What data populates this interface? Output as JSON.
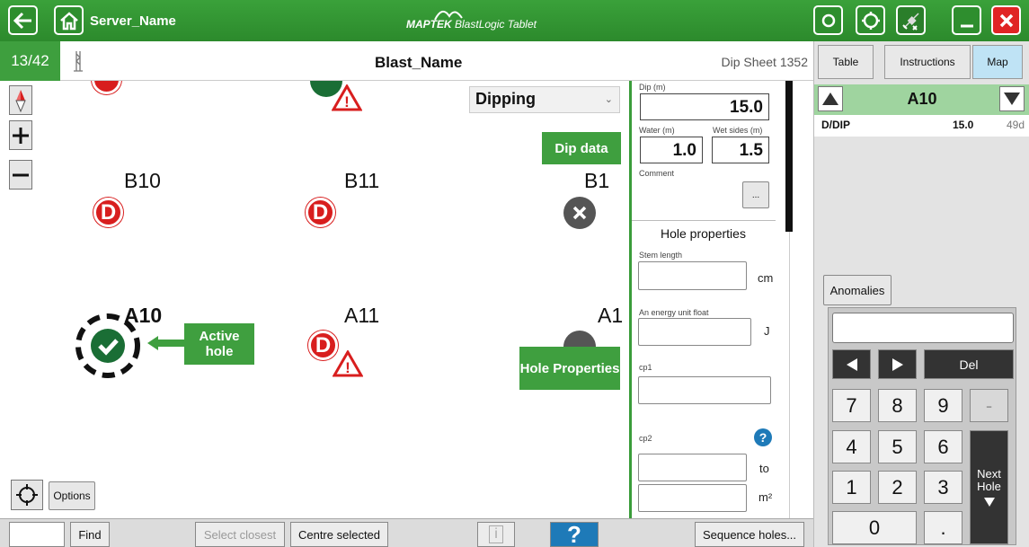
{
  "topbar": {
    "server_name": "Server_Name",
    "brand_logo": "MAPTEK",
    "brand_app": "BlastLogic Tablet",
    "icons": [
      "back-arrow-icon",
      "home-icon",
      "sync-icon",
      "gps-target-icon",
      "satellite-off-icon",
      "minimize-icon",
      "close-icon"
    ],
    "close_color": "#e02424"
  },
  "subheader": {
    "counter": "13/42",
    "blast_name": "Blast_Name",
    "dip_sheet": "Dip Sheet 1352"
  },
  "map": {
    "holes": [
      {
        "label": "B10",
        "status": "D"
      },
      {
        "label": "B11",
        "status": "D"
      },
      {
        "label": "B1",
        "status": "x"
      },
      {
        "label": "A10",
        "status": "active"
      },
      {
        "label": "A11",
        "status": "D-warning"
      },
      {
        "label": "A1",
        "status": "x"
      }
    ],
    "dip_data_callout": "Dip data",
    "active_hole_callout": "Active hole",
    "hole_properties_callout": "Hole Properties",
    "mode_select": "Dipping",
    "options_label": "Options"
  },
  "dip_panel": {
    "dip_label": "Dip (m)",
    "dip_value": "15.0",
    "water_label": "Water (m)",
    "water_value": "1.0",
    "wet_sides_label": "Wet sides (m)",
    "wet_sides_value": "1.5",
    "comment_label": "Comment",
    "comment_button": "...",
    "hole_properties_title": "Hole properties",
    "stem_length_label": "Stem length",
    "stem_length_unit": "cm",
    "energy_label": "An energy unit float",
    "energy_unit": "J",
    "cp1_label": "cp1",
    "cp2_label": "cp2",
    "cp2_to": "to",
    "cp2_unit": "m²",
    "help_icon": "?"
  },
  "right_panel": {
    "tabs": [
      "Table",
      "Instructions",
      "Map"
    ],
    "active_tab": "Map",
    "hole_name": "A10",
    "row": {
      "type": "D/DIP",
      "value": "15.0",
      "age": "49d"
    },
    "anomalies_label": "Anomalies",
    "keypad": {
      "del": "Del",
      "digits": [
        "7",
        "8",
        "9",
        "4",
        "5",
        "6",
        "1",
        "2",
        "3",
        "0",
        "."
      ],
      "minus": "-",
      "next_hole": "Next Hole"
    }
  },
  "bottombar": {
    "find": "Find",
    "select_closest": "Select closest",
    "centre_selected": "Centre selected",
    "info": "i",
    "help": "?",
    "sequence_holes": "Sequence holes..."
  }
}
